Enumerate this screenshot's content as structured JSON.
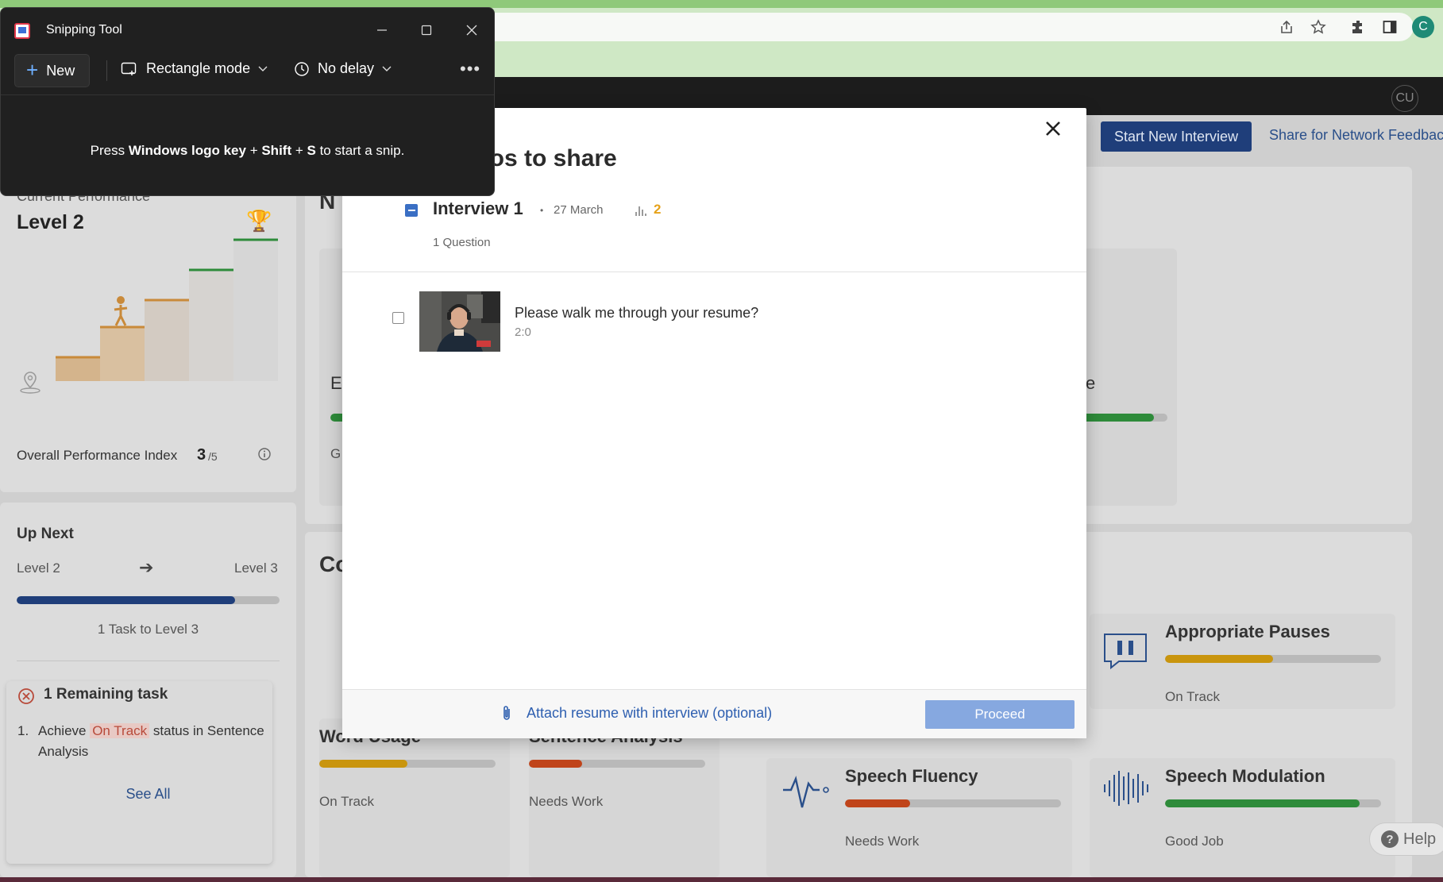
{
  "snipping_tool": {
    "title": "Snipping Tool",
    "new_label": "New",
    "mode_label": "Rectangle mode",
    "delay_label": "No delay",
    "more_label": "•••",
    "hint_prefix": "Press ",
    "hint_key1": "Windows logo key",
    "hint_plus1": " + ",
    "hint_key2": "Shift",
    "hint_plus2": " + ",
    "hint_key3": "S",
    "hint_suffix": " to start a snip."
  },
  "header": {
    "avatar": "CU",
    "start_button": "Start New Interview",
    "share_link": "Share for Network Feedbac"
  },
  "performance": {
    "heading": "Current Performance",
    "level": "Level 2",
    "index_label": "Overall Performance Index",
    "index_value": "3",
    "index_max": "/5"
  },
  "up_next": {
    "heading": "Up Next",
    "from_level": "Level 2",
    "to_level": "Level 3",
    "progress": 0.83,
    "tasks_to_level": "1 Task to Level 3",
    "remaining_heading": "1 Remaining task",
    "task_number": "1.",
    "task_prefix": "Achieve ",
    "task_status": "On Track",
    "task_suffix": " status in Sentence",
    "task_line2": "Analysis",
    "see_all": "See All"
  },
  "bg_fragments": {
    "n_fragment": "N",
    "e_fragment": "E",
    "g_fragment": "G",
    "c_fragment": "Co",
    "e_end_fragment": "e"
  },
  "metrics": [
    {
      "name": "Word Usage",
      "status": "On Track",
      "progress": 0.5,
      "color": "#c9950e"
    },
    {
      "name": "Sentence Analysis",
      "status": "Needs Work",
      "progress": 0.3,
      "color": "#c0441a"
    },
    {
      "name": "Appropriate Pauses",
      "status": "On Track",
      "progress": 0.5,
      "color": "#c9950e"
    },
    {
      "name": "Speech Fluency",
      "status": "Needs Work",
      "progress": 0.3,
      "color": "#c0441a"
    },
    {
      "name": "Speech Modulation",
      "status": "Good Job",
      "progress": 0.9,
      "color": "#2e8b3a"
    }
  ],
  "modal": {
    "title": "eos to share",
    "interview_title": "Interview 1",
    "dot": "•",
    "date": "27 March",
    "count": "2",
    "question_count": "1 Question",
    "question_text": "Please walk me through your resume?",
    "question_duration": "2:0",
    "attach_label": "Attach resume with interview (optional)",
    "proceed_label": "Proceed"
  },
  "help": {
    "label": "Help"
  },
  "colors": {
    "accent_blue": "#1f3e7a",
    "link_blue": "#2e5fb0",
    "warning": "#e6a21a"
  }
}
